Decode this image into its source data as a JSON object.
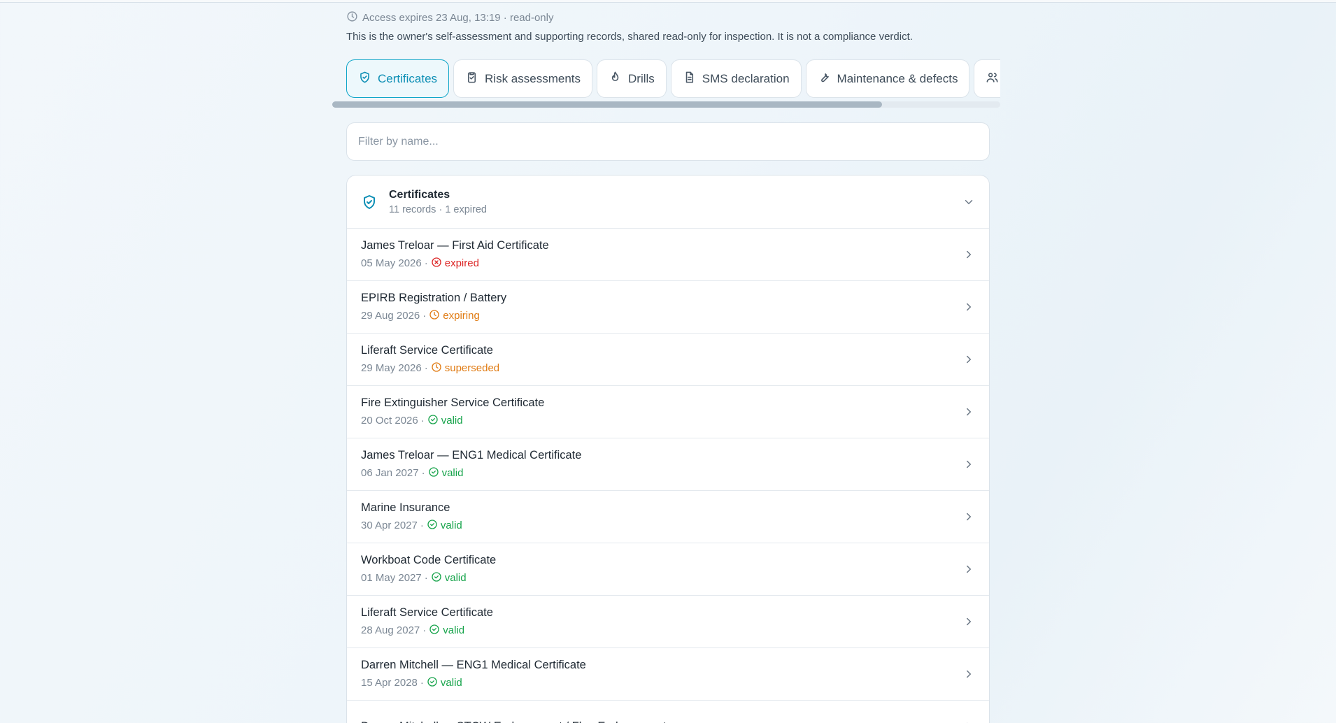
{
  "access": {
    "text": "Access expires 23 Aug, 13:19 · read-only",
    "icon": "clock-icon"
  },
  "notice": "This is the owner's self-assessment and supporting records, shared read-only for inspection. It is not a compliance verdict.",
  "tabs": [
    {
      "label": "Certificates",
      "icon": "shield-check-icon",
      "active": true
    },
    {
      "label": "Risk assessments",
      "icon": "clipboard-check-icon"
    },
    {
      "label": "Drills",
      "icon": "flame-icon"
    },
    {
      "label": "SMS declaration",
      "icon": "document-icon"
    },
    {
      "label": "Maintenance & defects",
      "icon": "wrench-icon"
    },
    {
      "label": "",
      "icon": "users-icon"
    }
  ],
  "filter": {
    "placeholder": "Filter by name..."
  },
  "section": {
    "title": "Certificates",
    "subtitle": "11 records · 1 expired",
    "icon": "shield-check-icon"
  },
  "colors": {
    "accent": "#0e8fb5",
    "expired": "#dc2626",
    "warning": "#e07b13",
    "valid": "#16a34a"
  },
  "rows": [
    {
      "title": "James Treloar — First Aid Certificate",
      "date": "05 May 2026",
      "status": "expired"
    },
    {
      "title": "EPIRB Registration / Battery",
      "date": "29 Aug 2026",
      "status": "expiring"
    },
    {
      "title": "Liferaft Service Certificate",
      "date": "29 May 2026",
      "status": "superseded"
    },
    {
      "title": "Fire Extinguisher Service Certificate",
      "date": "20 Oct 2026",
      "status": "valid"
    },
    {
      "title": "James Treloar — ENG1 Medical Certificate",
      "date": "06 Jan 2027",
      "status": "valid"
    },
    {
      "title": "Marine Insurance",
      "date": "30 Apr 2027",
      "status": "valid"
    },
    {
      "title": "Workboat Code Certificate",
      "date": "01 May 2027",
      "status": "valid"
    },
    {
      "title": "Liferaft Service Certificate",
      "date": "28 Aug 2027",
      "status": "valid"
    },
    {
      "title": "Darren Mitchell — ENG1 Medical Certificate",
      "date": "15 Apr 2028",
      "status": "valid"
    },
    {
      "title": "Darren Mitchell — STCW Endorsement / Flag Endorsement",
      "date": "",
      "status": ""
    }
  ]
}
